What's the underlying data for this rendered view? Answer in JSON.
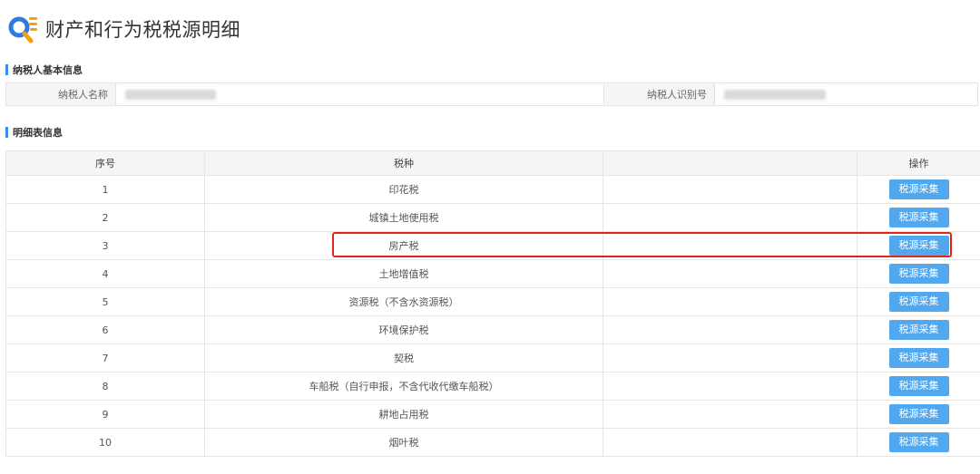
{
  "page": {
    "title": "财产和行为税税源明细",
    "logo_icon": "search-magnifier-list-icon",
    "accent_color": "#3b8ee8"
  },
  "taxpayer_section": {
    "title": "纳税人基本信息",
    "name_label": "纳税人名称",
    "id_label": "纳税人识别号"
  },
  "detail_section": {
    "title": "明细表信息",
    "columns": [
      "序号",
      "税种",
      "",
      "操作"
    ],
    "rows": [
      {
        "index": "1",
        "tax_type": "印花税",
        "action": "税源采集"
      },
      {
        "index": "2",
        "tax_type": "城镇土地使用税",
        "action": "税源采集"
      },
      {
        "index": "3",
        "tax_type": "房产税",
        "action": "税源采集"
      },
      {
        "index": "4",
        "tax_type": "土地增值税",
        "action": "税源采集"
      },
      {
        "index": "5",
        "tax_type": "资源税（不含水资源税）",
        "action": "税源采集"
      },
      {
        "index": "6",
        "tax_type": "环境保护税",
        "action": "税源采集"
      },
      {
        "index": "7",
        "tax_type": "契税",
        "action": "税源采集"
      },
      {
        "index": "8",
        "tax_type": "车船税（自行申报，不含代收代缴车船税）",
        "action": "税源采集"
      },
      {
        "index": "9",
        "tax_type": "耕地占用税",
        "action": "税源采集"
      },
      {
        "index": "10",
        "tax_type": "烟叶税",
        "action": "税源采集"
      }
    ],
    "button_color": "#51a8ee",
    "highlight_color": "#e0261c"
  }
}
